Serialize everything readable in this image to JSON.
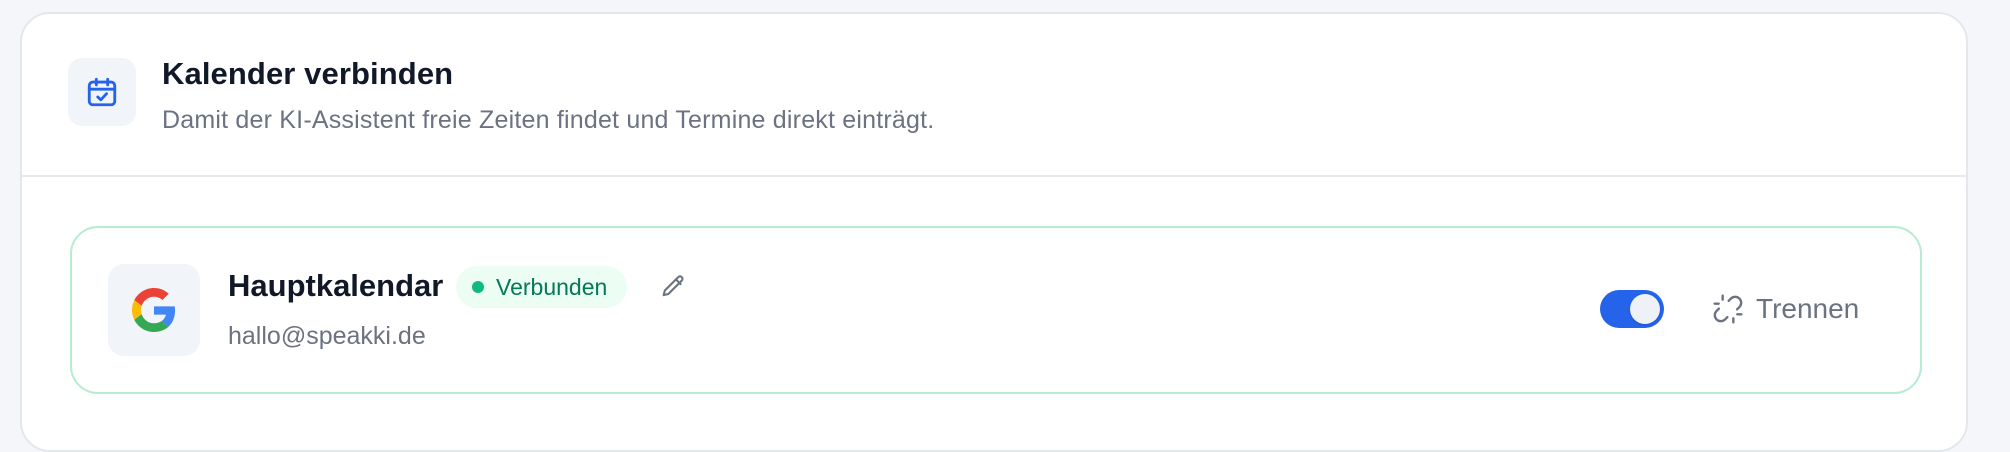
{
  "header": {
    "title": "Kalender verbinden",
    "description": "Damit der KI-Assistent freie Zeiten findet und Termine direkt einträgt.",
    "icon": "calendar-check-icon"
  },
  "calendar": {
    "provider": "google",
    "name": "Hauptkalendar",
    "status": "Verbunden",
    "email": "hallo@speakki.de",
    "enabled": true,
    "disconnect_label": "Trennen"
  },
  "colors": {
    "accent": "#2563eb",
    "status_green": "#10b981",
    "status_text": "#047857",
    "border_green": "#b6ecd1"
  }
}
